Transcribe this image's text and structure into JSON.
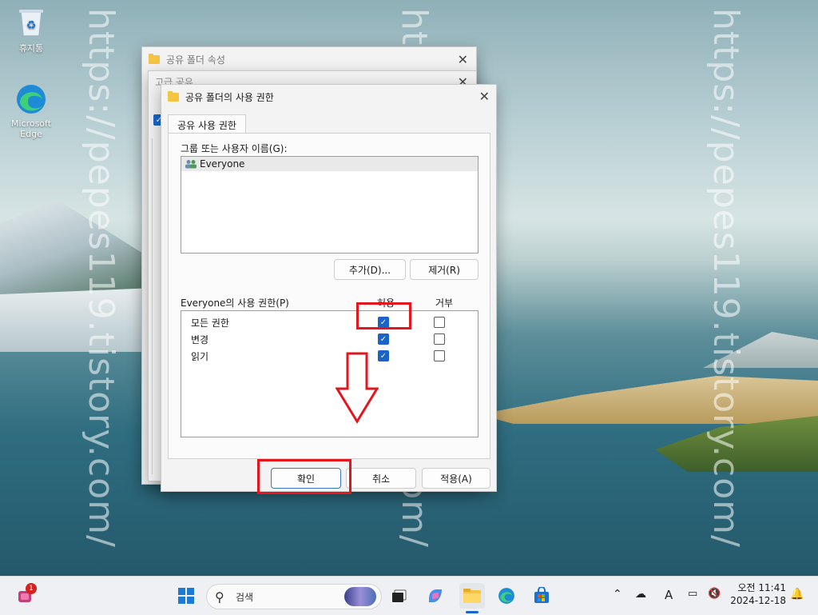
{
  "desktop": {
    "watermark": "https://pepes119.tistory.com/",
    "icons": [
      {
        "label": "휴지통"
      },
      {
        "label": "Microsoft Edge"
      }
    ]
  },
  "back_window": {
    "title": "공유 폴더 속성"
  },
  "mid_window": {
    "title": "고급 공유"
  },
  "dialog": {
    "title": "공유 폴더의 사용 권한",
    "tab": "공유 사용 권한",
    "group_label": "그룹 또는 사용자 이름(G):",
    "users": [
      "Everyone"
    ],
    "add_button": "추가(D)...",
    "remove_button": "제거(R)",
    "perm_label": "Everyone의 사용 권한(P)",
    "allow_header": "허용",
    "deny_header": "거부",
    "permissions": [
      {
        "name": "모든 권한",
        "allow": true,
        "deny": false
      },
      {
        "name": "변경",
        "allow": true,
        "deny": false
      },
      {
        "name": "읽기",
        "allow": true,
        "deny": false
      }
    ],
    "ok_button": "확인",
    "cancel_button": "취소",
    "apply_button": "적용(A)"
  },
  "taskbar": {
    "search_placeholder": "검색",
    "notification_badge": "1",
    "time": "오전 11:41",
    "date": "2024-12-18",
    "ime": "A"
  },
  "colors": {
    "accent": "#1a64c8",
    "highlight": "#e3161d",
    "folder": "#f6c443"
  }
}
